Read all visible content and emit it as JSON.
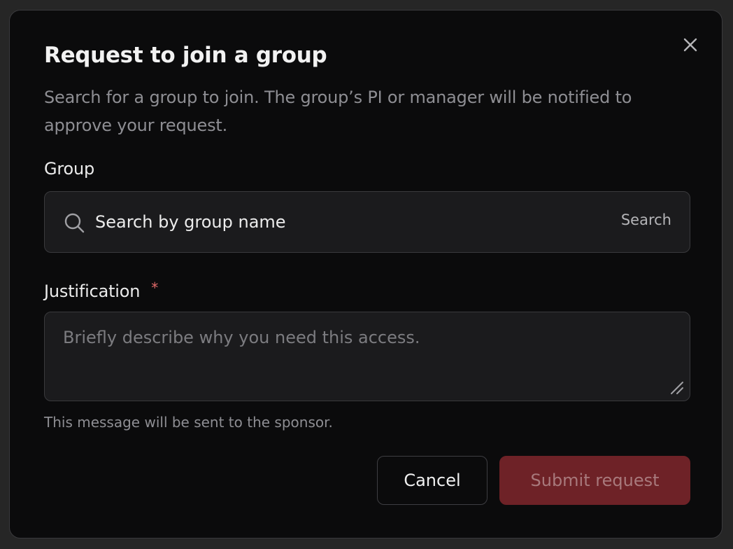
{
  "dialog": {
    "title": "Request to join a group",
    "description": "Search for a group to join. The group’s PI or manager will be notified to approve your request.",
    "close_icon": "close-icon"
  },
  "group_field": {
    "label": "Group",
    "placeholder": "Search by group name",
    "value": "",
    "hint": "Search",
    "icon": "search-icon"
  },
  "justification_field": {
    "label": "Justification",
    "required_marker": "*",
    "placeholder": "Briefly describe why you need this access.",
    "value": "",
    "helper_text": "This message will be sent to the sponsor.",
    "resize_icon": "resize-handle-icon"
  },
  "actions": {
    "cancel_label": "Cancel",
    "submit_label": "Submit request"
  },
  "colors": {
    "background": "#0b0b0c",
    "border": "#3a3a3d",
    "required": "#e26a6a",
    "submit_bg": "#6e2227",
    "submit_text": "#a8797c"
  }
}
